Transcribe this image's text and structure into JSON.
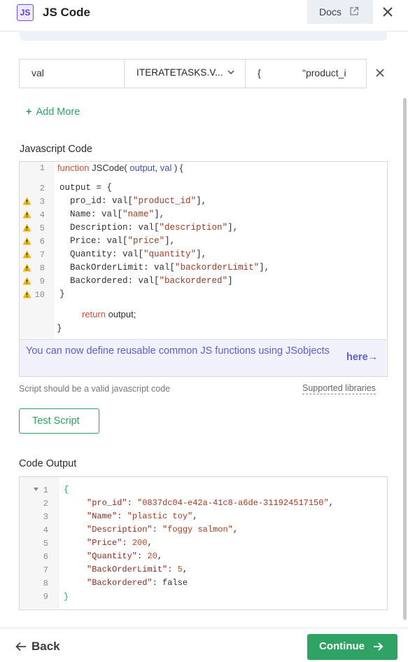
{
  "header": {
    "badge": "JS",
    "title": "JS Code",
    "docs_label": "Docs"
  },
  "inputs": {
    "key": "val",
    "source": "ITERATETASKS.V...",
    "value_brace": "{",
    "value_text": "\"product_i"
  },
  "add_more_label": "Add More",
  "javascript_code": {
    "label": "Javascript Code",
    "line_numbers": [
      "1",
      "2",
      "3",
      "4",
      "5",
      "6",
      "7",
      "8",
      "9",
      "10"
    ],
    "line1": {
      "kw": "function",
      "name": "JSCode(",
      "p1": "output",
      "comma": ",",
      "p2": "val",
      "close": ") {"
    },
    "line2": "output = {",
    "props": [
      {
        "key": "pro_id",
        "str": "product_id"
      },
      {
        "key": "Name",
        "str": "name"
      },
      {
        "key": "Description",
        "str": "description"
      },
      {
        "key": "Price",
        "str": "price"
      },
      {
        "key": "Quantity",
        "str": "quantity"
      },
      {
        "key": "BackOrderLimit",
        "str": "backorderLimit"
      },
      {
        "key": "Backordered",
        "str": "backordered"
      }
    ],
    "line10": "}",
    "return_kw": "return",
    "return_rest": "output;",
    "last_brace": "}"
  },
  "tip": {
    "text": "You can now define reusable common JS functions using JSobjects",
    "link": "here"
  },
  "script_hint": "Script should be a valid javascript code",
  "supported_libraries": "Supported libraries",
  "test_button": "Test Script",
  "output": {
    "label": "Code Output",
    "line_numbers": [
      "1",
      "2",
      "3",
      "4",
      "5",
      "6",
      "7",
      "8",
      "9"
    ],
    "open": "{",
    "close": "}",
    "rows": [
      {
        "key": "\"pro_id\"",
        "sep": ": ",
        "val": "\"0837dc04-e42a-41c8-a6de-311924517150\"",
        "kind": "str",
        "tail": ","
      },
      {
        "key": "\"Name\"",
        "sep": ": ",
        "val": "\"plastic toy\"",
        "kind": "str",
        "tail": ","
      },
      {
        "key": "\"Description\"",
        "sep": ": ",
        "val": "\"foggy salmon\"",
        "kind": "str",
        "tail": ","
      },
      {
        "key": "\"Price\"",
        "sep": ": ",
        "val": "200",
        "kind": "num",
        "tail": ","
      },
      {
        "key": "\"Quantity\"",
        "sep": ": ",
        "val": "20",
        "kind": "num",
        "tail": ","
      },
      {
        "key": "\"BackOrderLimit\"",
        "sep": ": ",
        "val": "5",
        "kind": "num",
        "tail": ","
      },
      {
        "key": "\"Backordered\"",
        "sep": ": ",
        "val": "false",
        "kind": "plain",
        "tail": ""
      }
    ]
  },
  "footer": {
    "back_label": "Back",
    "continue_label": "Continue"
  },
  "colors": {
    "accent_green": "#2fa363",
    "accent_purple": "#5b5fcf",
    "warning_yellow": "#f2b600"
  },
  "icons": [
    "js-badge-icon",
    "external-link-icon",
    "close-icon",
    "chevron-down-icon",
    "remove-icon",
    "plus-icon",
    "warning-icon",
    "arrow-right-icon",
    "arrow-left-icon",
    "fold-arrow-icon"
  ]
}
